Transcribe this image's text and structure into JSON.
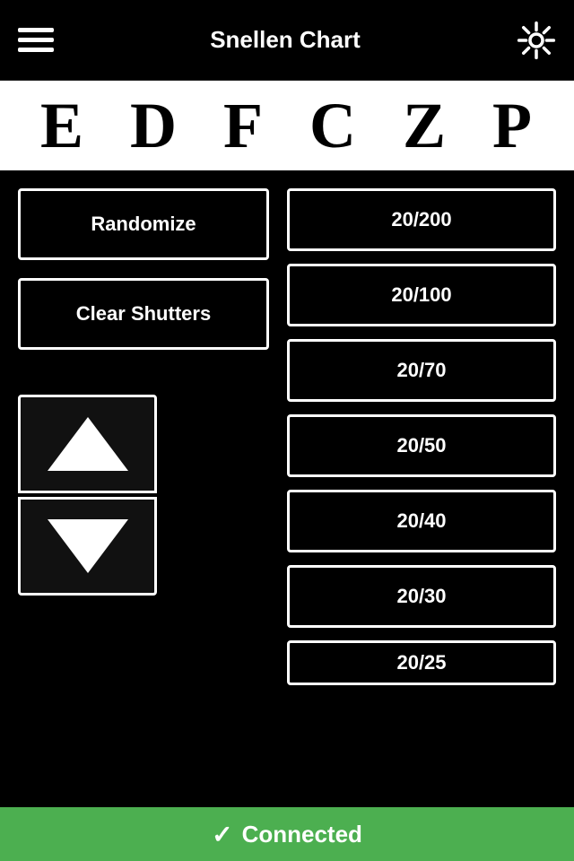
{
  "header": {
    "title": "Snellen Chart",
    "menu_label": "menu",
    "settings_label": "settings"
  },
  "eye_chart": {
    "letters": [
      "E",
      "D",
      "F",
      "C",
      "Z",
      "P"
    ]
  },
  "left_controls": {
    "randomize_label": "Randomize",
    "clear_shutters_label": "Clear Shutters",
    "arrow_up_label": "up",
    "arrow_down_label": "down"
  },
  "vision_buttons": [
    {
      "label": "20/200"
    },
    {
      "label": "20/100"
    },
    {
      "label": "20/70"
    },
    {
      "label": "20/50"
    },
    {
      "label": "20/40"
    },
    {
      "label": "20/30"
    },
    {
      "label": "20/25"
    }
  ],
  "status_bar": {
    "connected_label": "Connected",
    "check_symbol": "✓",
    "bg_color": "#4caf50"
  }
}
